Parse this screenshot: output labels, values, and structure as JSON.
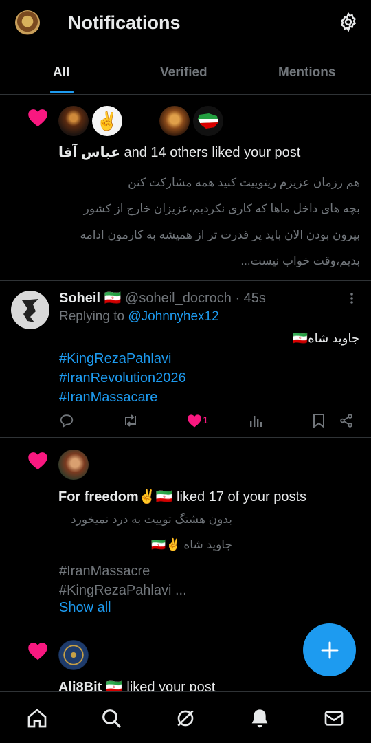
{
  "header": {
    "title": "Notifications"
  },
  "tabs": [
    {
      "label": "All"
    },
    {
      "label": "Verified"
    },
    {
      "label": "Mentions"
    }
  ],
  "notif1": {
    "name": "عباس آقا",
    "action": " and 14 others liked your post",
    "lines": [
      "هم رزمان عزیزم ریتوییت کنید همه مشارکت کنن",
      "بچه های داخل ماها که کاری نکردیم،عزیزان خارج از کشور",
      "بیرون بودن الان باید پر قدرت تر از همیشه به کارمون ادامه",
      "بدیم،وقت خواب نیست..."
    ]
  },
  "tweet": {
    "name": "Soheil 🇮🇷",
    "handle": "@soheil_docroch",
    "time": "· 45s",
    "replying_prefix": "Replying to ",
    "replying_to": "@Johnnyhex12",
    "body": "جاوید شاه🇮🇷",
    "hashtags": [
      "#KingRezaPahlavi",
      "#IranRevolution2026",
      "#IranMassacare"
    ],
    "like_count": "1"
  },
  "notif2": {
    "name": "For freedom✌️🇮🇷",
    "action": " liked 17 of your posts",
    "line1": "بدون هشتگ توییت به درد نمیخورد",
    "line2": "جاوید شاه ✌️🇮🇷",
    "hashtag1": "#IranMassacre",
    "hashtag2": "#KingRezaPahlavi ...",
    "show_all": "Show all"
  },
  "notif3": {
    "name": "Ali8Bit 🇮🇷",
    "action": " liked your post"
  },
  "colors": {
    "accent": "#1d9bf0",
    "like": "#f91880",
    "bg": "#000000"
  }
}
